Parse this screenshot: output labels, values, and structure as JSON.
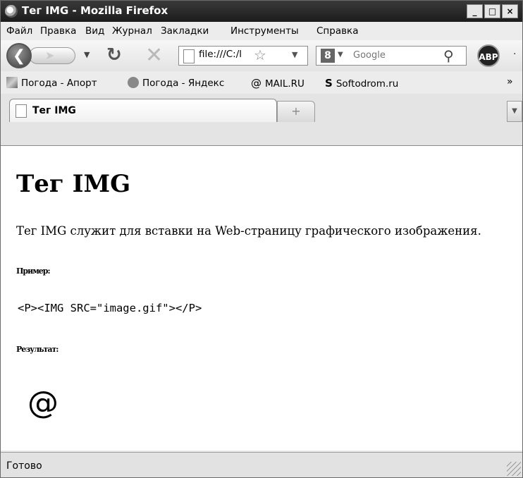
{
  "window": {
    "title": "Тег IMG - Mozilla Firefox",
    "controls": {
      "minimize": "_",
      "maximize": "□",
      "close": "×"
    }
  },
  "menu": [
    "Файл",
    "Правка",
    "Вид",
    "Журнал",
    "Закладки",
    "Инструменты",
    "Справка"
  ],
  "toolbar": {
    "back_icon": "arrow-left-icon",
    "forward_icon": "arrow-right-icon",
    "reload_icon": "reload-icon",
    "stop_icon": "stop-icon",
    "url_value": "file:///C:/l",
    "search_placeholder": "Google",
    "addon_label": "ABP",
    "more": "·"
  },
  "bookmarks": [
    {
      "label": "Погода - Апорт",
      "icon": "weather-icon"
    },
    {
      "label": "Погода - Яндекс",
      "icon": "yandex-weather-icon"
    },
    {
      "label": "MAIL.RU",
      "icon": "at-sign-icon"
    },
    {
      "label": "Softodrom.ru",
      "icon": "softodrom-icon"
    }
  ],
  "bookmarks_more": "»",
  "tabs": [
    {
      "label": "Тег IMG",
      "active": true
    }
  ],
  "new_tab_label": "+",
  "page": {
    "heading": "Тег IMG",
    "intro": "Тег IMG служит для вставки на Web-страницу графического изображения.",
    "example_label": "Пример:",
    "code": "<P><IMG SRC=\"image.gif\"></P>",
    "result_label": "Результат:",
    "result_glyph": "@"
  },
  "status": {
    "text": "Готово"
  },
  "colors": {
    "titlebar": "#2a2a2a",
    "chrome": "#ececec",
    "page_bg": "#ffffff"
  }
}
